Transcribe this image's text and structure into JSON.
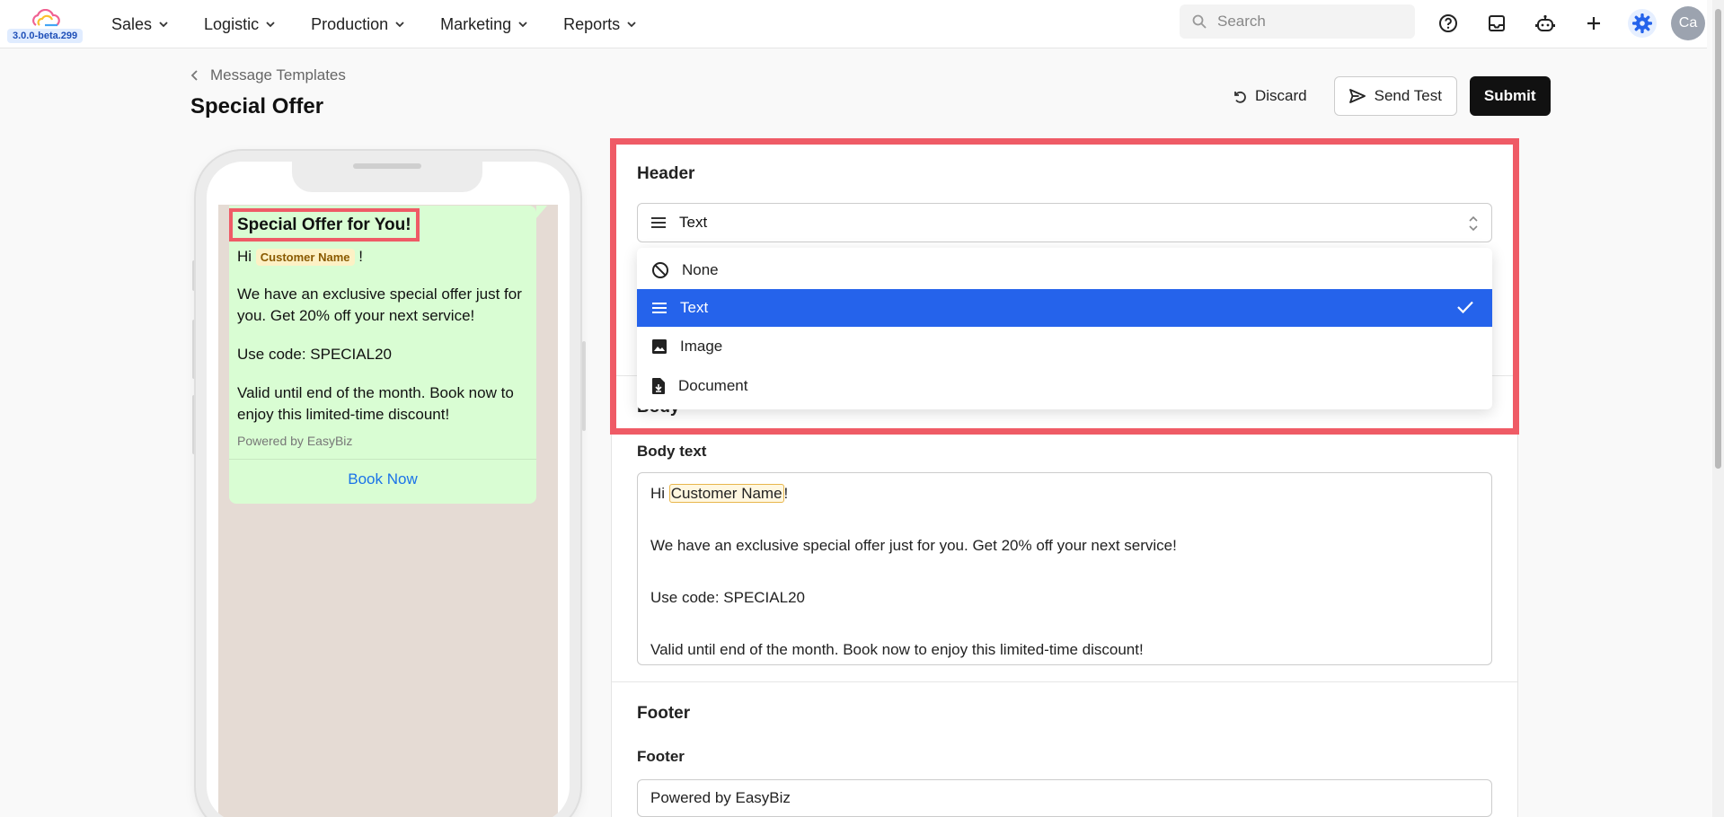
{
  "app": {
    "version": "3.0.0-beta.299",
    "nav": [
      "Sales",
      "Logistic",
      "Production",
      "Marketing",
      "Reports"
    ],
    "search_placeholder": "Search",
    "avatar_initials": "Ca"
  },
  "page": {
    "breadcrumb": "Message Templates",
    "title": "Special Offer",
    "actions": {
      "discard": "Discard",
      "send_test": "Send Test",
      "submit": "Submit"
    }
  },
  "preview": {
    "header_text": "Special Offer for You!",
    "greeting_prefix": "Hi",
    "variable": "Customer Name",
    "greeting_suffix": "!",
    "para1": "We have an exclusive special offer just for you. Get 20% off your next service!",
    "para2": "Use code: SPECIAL20",
    "para3": "Valid until end of the month. Book now to enjoy this limited-time discount!",
    "footer": "Powered by EasyBiz",
    "button": "Book Now"
  },
  "form": {
    "header_section": "Header",
    "header_selected": "Text",
    "header_options": [
      "None",
      "Text",
      "Image",
      "Document"
    ],
    "body_section": "Body",
    "body_label": "Body text",
    "body_lines": {
      "prefix": "Hi ",
      "variable": "Customer Name",
      "suffix": "!",
      "line2": "We have an exclusive special offer just for you. Get 20% off your next service!",
      "line3": "Use code: SPECIAL20",
      "line4": "Valid until end of the month. Book now to enjoy this limited-time discount!"
    },
    "footer_section": "Footer",
    "footer_label": "Footer",
    "footer_value": "Powered by EasyBiz"
  },
  "colors": {
    "accent": "#2563eb",
    "highlight": "#ef5b66",
    "bubble": "#d9fdd3"
  }
}
